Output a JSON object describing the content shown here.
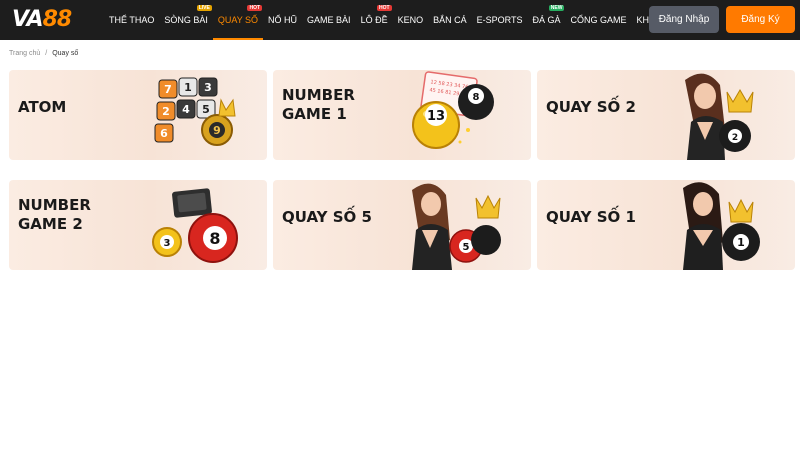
{
  "header": {
    "logo": {
      "part1": "VA",
      "part2": "88"
    },
    "nav": [
      {
        "label": "THỂ THAO",
        "badge": "",
        "badge_color": "",
        "active": false
      },
      {
        "label": "SÒNG BÀI",
        "badge": "LIVE",
        "badge_color": "#e4a300",
        "active": false
      },
      {
        "label": "QUAY SỐ",
        "badge": "HOT",
        "badge_color": "#e53935",
        "active": true
      },
      {
        "label": "NỔ HŨ",
        "badge": "",
        "badge_color": "",
        "active": false
      },
      {
        "label": "GAME BÀI",
        "badge": "",
        "badge_color": "",
        "active": false
      },
      {
        "label": "LÔ ĐỀ",
        "badge": "HOT",
        "badge_color": "#e53935",
        "active": false
      },
      {
        "label": "KENO",
        "badge": "",
        "badge_color": "",
        "active": false
      },
      {
        "label": "BẮN CÁ",
        "badge": "",
        "badge_color": "",
        "active": false
      },
      {
        "label": "E-SPORTS",
        "badge": "",
        "badge_color": "",
        "active": false
      },
      {
        "label": "ĐÁ GÀ",
        "badge": "NEW",
        "badge_color": "#27ae60",
        "active": false
      },
      {
        "label": "CỔNG GAME",
        "badge": "",
        "badge_color": "",
        "active": false
      },
      {
        "label": "KHUYẾN MÃI",
        "badge": "",
        "badge_color": "",
        "active": false
      }
    ],
    "login_label": "Đăng Nhập",
    "register_label": "Đăng Ký"
  },
  "breadcrumb": {
    "home": "Trang chủ",
    "separator": "/",
    "current": "Quay số"
  },
  "colors": {
    "accent": "#ff7a00",
    "header_bg": "#1d1d1d",
    "login_bg": "#565b66"
  },
  "games": [
    {
      "title": "ATOM",
      "art": "number-tiles-icon"
    },
    {
      "title": "NUMBER\nGAME 1",
      "art": "lottery-balls-icon",
      "ball_numbers": [
        "13",
        "8"
      ]
    },
    {
      "title": "QUAY SỐ 2",
      "art": "dealer-with-ball-icon",
      "ball_numbers": [
        "2"
      ]
    },
    {
      "title": "NUMBER\nGAME 2",
      "art": "bingo-balls-icon",
      "ball_numbers": [
        "3",
        "8"
      ]
    },
    {
      "title": "QUAY SỐ 5",
      "art": "dealer-with-ball-icon",
      "ball_numbers": [
        "5"
      ]
    },
    {
      "title": "QUAY SỐ 1",
      "art": "dealer-with-ball-icon",
      "ball_numbers": [
        "1"
      ]
    }
  ],
  "tile_numbers": [
    "7",
    "1",
    "3",
    "2",
    "4",
    "5",
    "6",
    "9"
  ]
}
